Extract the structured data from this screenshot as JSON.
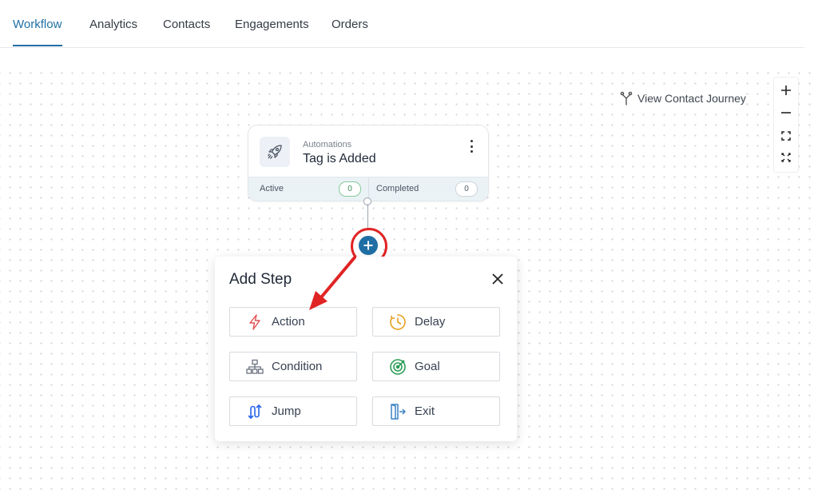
{
  "tabs": [
    {
      "label": "Workflow",
      "active": true
    },
    {
      "label": "Analytics"
    },
    {
      "label": "Contacts"
    },
    {
      "label": "Engagements"
    },
    {
      "label": "Orders"
    }
  ],
  "journey": {
    "label": "View Contact Journey",
    "icon": "branch-icon"
  },
  "zoom": {
    "zoom_in_icon": "plus-icon",
    "zoom_out_icon": "minus-icon",
    "fit_icon": "fit-screen-icon",
    "fullscreen_icon": "expand-icon"
  },
  "trigger": {
    "category": "Automations",
    "title": "Tag is Added",
    "icon": "rocket-icon",
    "active_label": "Active",
    "active_count": "0",
    "completed_label": "Completed",
    "completed_count": "0"
  },
  "modal": {
    "title": "Add Step",
    "options": [
      {
        "label": "Action",
        "icon": "lightning-icon",
        "color": "#e05252"
      },
      {
        "label": "Delay",
        "icon": "clock-icon",
        "color": "#e8a020"
      },
      {
        "label": "Condition",
        "icon": "hierarchy-icon",
        "color": "#6b7280"
      },
      {
        "label": "Goal",
        "icon": "target-icon",
        "color": "#2f9e57"
      },
      {
        "label": "Jump",
        "icon": "jump-icon",
        "color": "#2563eb"
      },
      {
        "label": "Exit",
        "icon": "exit-icon",
        "color": "#3b82c4"
      }
    ]
  },
  "colors": {
    "accent": "#1f6fa5",
    "highlight": "#e02424"
  }
}
